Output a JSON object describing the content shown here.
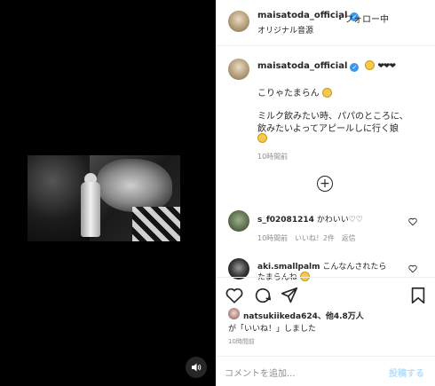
{
  "header": {
    "username": "maisatoda_official",
    "follow_status": "・フォロー中",
    "audio": "オリジナル音源"
  },
  "caption": {
    "username": "maisatoda_official",
    "hearts": "❤❤❤",
    "line1": "こりゃたまらん",
    "line2": "ミルク飲みたい時、パパのところに、",
    "line3": "飲みたいよってアピールしに行く娘",
    "time": "10時間前"
  },
  "comments": [
    {
      "username": "s_f02081214",
      "text": "かわいい♡♡",
      "time": "10時間前",
      "likes": "いいね！2件",
      "reply": "返信"
    },
    {
      "username": "aki.smallpalm",
      "text": "こんなんされたら",
      "text2": "たまらんね"
    }
  ],
  "likes": {
    "line1_user": "natsukiikeda624",
    "line1_rest": "、他4.8万人",
    "line2": "が「いいね！」しました"
  },
  "post_time": "10時間前",
  "comment_bar": {
    "placeholder": "コメントを追加...",
    "post_label": "投稿する"
  },
  "icons": {
    "mute": "speaker-icon",
    "load_more": "plus-circle-icon",
    "like": "heart-icon",
    "comment": "comment-icon",
    "share": "paper-plane-icon",
    "save": "bookmark-icon"
  },
  "colors": {
    "verified": "#3897f0",
    "post_button": "#b2dffc",
    "media_bg": "#000000"
  }
}
